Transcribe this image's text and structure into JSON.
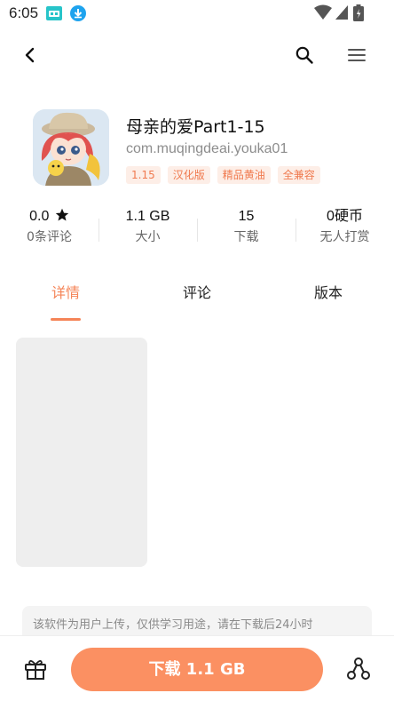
{
  "status_bar": {
    "time": "6:05",
    "icons": [
      "game-controller-icon",
      "download-notification-icon",
      "wifi-icon",
      "signal-icon",
      "battery-icon"
    ]
  },
  "toolbar": {
    "back_icon": "chevron-left-icon",
    "search_icon": "search-icon",
    "menu_icon": "hamburger-menu-icon"
  },
  "app": {
    "title": "母亲的爱Part1-15",
    "package": "com.muqingdeai.youka01",
    "tags": [
      "1.15",
      "汉化版",
      "精品黄油",
      "全兼容"
    ]
  },
  "stats": [
    {
      "value": "0.0",
      "label": "0条评论",
      "icon": "star-icon"
    },
    {
      "value": "1.1 GB",
      "label": "大小"
    },
    {
      "value": "15",
      "label": "下载"
    },
    {
      "value": "0硬币",
      "label": "无人打赏"
    }
  ],
  "tabs": [
    {
      "label": "详情",
      "active": true
    },
    {
      "label": "评论",
      "active": false
    },
    {
      "label": "版本",
      "active": false
    }
  ],
  "disclaimer": "该软件为用户上传，仅供学习用途，请在下载后24小时",
  "bottom_bar": {
    "gift_icon": "gift-icon",
    "download_label": "下载 1.1 GB",
    "share_icon": "share-network-icon"
  },
  "colors": {
    "accent": "#f58457",
    "download_button": "#fb9062",
    "tag_bg": "#fdeee7",
    "tag_text": "#f07a4f"
  }
}
